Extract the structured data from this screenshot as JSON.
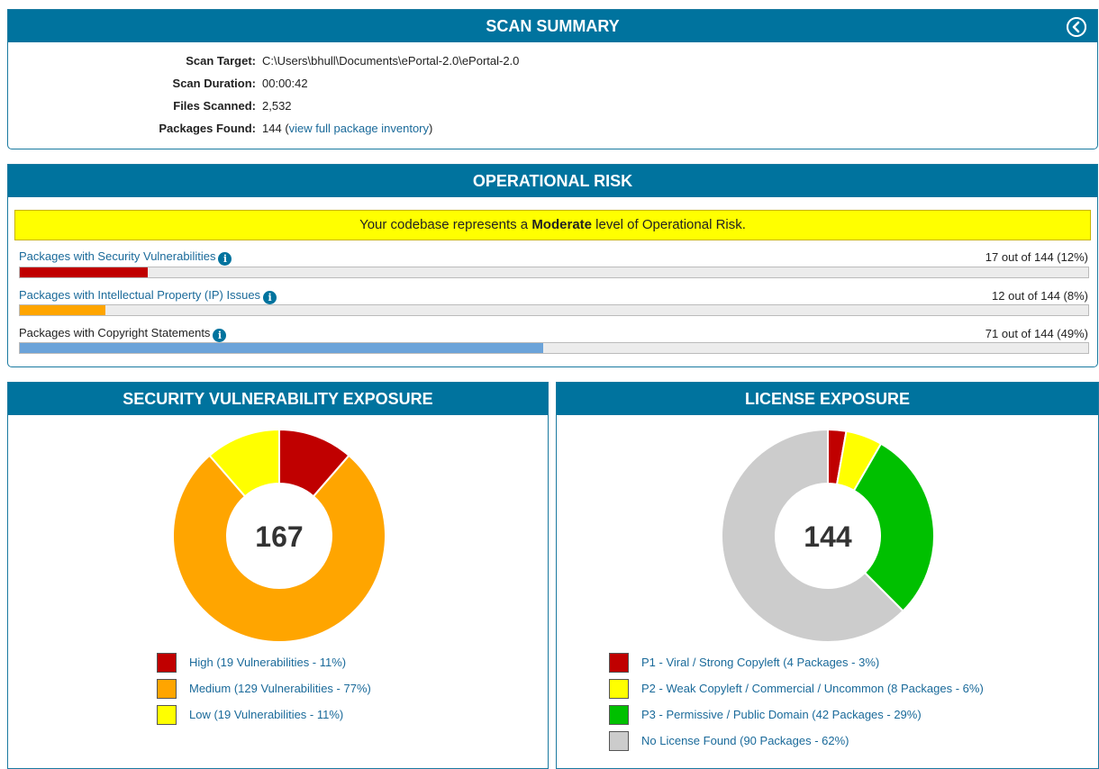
{
  "summary": {
    "title": "SCAN SUMMARY",
    "rows": [
      {
        "label": "Scan Target:",
        "value": "C:\\Users\\bhull\\Documents\\ePortal-2.0\\ePortal-2.0"
      },
      {
        "label": "Scan Duration:",
        "value": "00:00:42"
      },
      {
        "label": "Files Scanned:",
        "value": "2,532"
      }
    ],
    "packages_label": "Packages Found:",
    "packages_count": "144",
    "packages_link": "view full package inventory"
  },
  "risk": {
    "title": "OPERATIONAL RISK",
    "banner_pre": "Your codebase represents a ",
    "banner_level": "Moderate",
    "banner_post": " level of Operational Risk.",
    "metrics": [
      {
        "label": "Packages with Security Vulnerabilities",
        "count": "17 out of 144 (12%)",
        "fraction": 0.12,
        "color": "#c00000",
        "link": true
      },
      {
        "label": "Packages with Intellectual Property (IP) Issues",
        "count": "12 out of 144 (8%)",
        "fraction": 0.08,
        "color": "#ffa500",
        "link": true
      },
      {
        "label": "Packages with Copyright Statements",
        "count": "71 out of 144 (49%)",
        "fraction": 0.49,
        "color": "#6ba3d9",
        "link": false
      }
    ]
  },
  "security": {
    "title": "SECURITY VULNERABILITY EXPOSURE",
    "total": "167",
    "legend": [
      {
        "label": "High (19 Vulnerabilities - 11%)",
        "value": 19,
        "color": "#c00000"
      },
      {
        "label": "Medium (129 Vulnerabilities - 77%)",
        "value": 129,
        "color": "#ffa500"
      },
      {
        "label": "Low (19 Vulnerabilities - 11%)",
        "value": 19,
        "color": "#ffff00"
      }
    ]
  },
  "license": {
    "title": "LICENSE EXPOSURE",
    "total": "144",
    "legend": [
      {
        "label": "P1 - Viral / Strong Copyleft (4 Packages - 3%)",
        "value": 4,
        "color": "#c00000"
      },
      {
        "label": "P2 - Weak Copyleft / Commercial / Uncommon (8 Packages - 6%)",
        "value": 8,
        "color": "#ffff00"
      },
      {
        "label": "P3 - Permissive / Public Domain (42 Packages - 29%)",
        "value": 42,
        "color": "#00c000"
      },
      {
        "label": "No License Found (90 Packages - 62%)",
        "value": 90,
        "color": "#cccccc"
      }
    ]
  },
  "icons": {
    "collapse": "circle-chevron-left-icon",
    "info": "info-icon"
  }
}
